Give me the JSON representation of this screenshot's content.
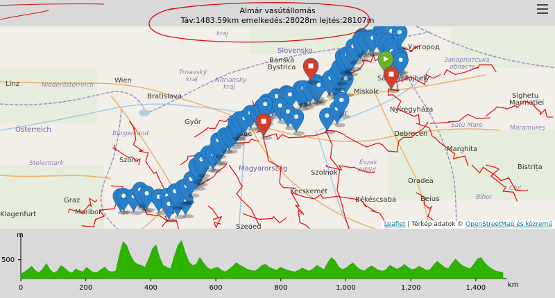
{
  "header": {
    "title": "Almár vasútállomás",
    "stats": "Táv:1483.59km emelkedés:28028m lejtés:28107m"
  },
  "map": {
    "places": [
      {
        "name": "Banská",
        "cls": "big"
      },
      {
        "name": "Bystrica",
        "cls": "big"
      },
      {
        "name": "Slovensko",
        "cls": "country"
      },
      {
        "name": "Ужгород",
        "cls": "big"
      },
      {
        "name": "Закарпатська",
        "cls": "region"
      },
      {
        "name": "область",
        "cls": "region"
      },
      {
        "name": "kraj",
        "cls": "region"
      },
      {
        "name": "Linz",
        "cls": "big"
      },
      {
        "name": "Niederösterreich",
        "cls": "region"
      },
      {
        "name": "Wien",
        "cls": "big"
      },
      {
        "name": "Trnavský",
        "cls": "region"
      },
      {
        "name": "kraj",
        "cls": "region"
      },
      {
        "name": "Nitriansky",
        "cls": "region"
      },
      {
        "name": "kraj",
        "cls": "region"
      },
      {
        "name": "Bratislava",
        "cls": "big"
      },
      {
        "name": "Sighetu",
        "cls": "big"
      },
      {
        "name": "Marmației",
        "cls": "big"
      },
      {
        "name": "Österreich",
        "cls": "country"
      },
      {
        "name": "Nyíregyháza",
        "cls": "big"
      },
      {
        "name": "Satu Mare",
        "cls": "region"
      },
      {
        "name": "Maramureș",
        "cls": "region"
      },
      {
        "name": "Eger",
        "cls": "big"
      },
      {
        "name": "Debrecen",
        "cls": "big"
      },
      {
        "name": "Burgenland",
        "cls": "region"
      },
      {
        "name": "Steiermark",
        "cls": "region"
      },
      {
        "name": "Marghita",
        "cls": "big"
      },
      {
        "name": "Bistrița",
        "cls": "big"
      },
      {
        "name": "Magyarország",
        "cls": "country"
      },
      {
        "name": "Szolnok",
        "cls": "big"
      },
      {
        "name": "Graz",
        "cls": "big"
      },
      {
        "name": "Oradea",
        "cls": "big"
      },
      {
        "name": "Kecskemét",
        "cls": "big"
      },
      {
        "name": "Cluj",
        "cls": "region"
      },
      {
        "name": "Zalaegerszeg",
        "cls": "big"
      },
      {
        "name": "Békéscsaba",
        "cls": "big"
      },
      {
        "name": "Beius",
        "cls": "big"
      },
      {
        "name": "Maribor",
        "cls": "big"
      },
      {
        "name": "Klagenfurt",
        "cls": "big"
      },
      {
        "name": "Szeged",
        "cls": "big"
      },
      {
        "name": "Észak",
        "cls": "region"
      },
      {
        "name": "Alföld",
        "cls": "region"
      },
      {
        "name": "Bihor",
        "cls": "region"
      },
      {
        "name": "Szom",
        "cls": "big"
      },
      {
        "name": "Győr",
        "cls": "big"
      },
      {
        "name": "Vác",
        "cls": "big"
      },
      {
        "name": "Sátoraljaújhely",
        "cls": "big"
      },
      {
        "name": "Miskolc",
        "cls": "big"
      }
    ],
    "attribution": {
      "leaflet": "Leaflet",
      "sep": " | Térkép adatok © ",
      "osm": "OpenStreetMap és közremű"
    }
  },
  "profile": {
    "y_axis_label": "m",
    "y_tick": "500",
    "x_unit": "km",
    "x_ticks": [
      "0",
      "200",
      "400",
      "600",
      "800",
      "1,000",
      "1,200",
      "1,400"
    ],
    "total_km": 1483.59,
    "fill_color": "#2db300",
    "elevation_samples_m": [
      120,
      180,
      250,
      330,
      210,
      160,
      260,
      400,
      240,
      150,
      200,
      350,
      280,
      190,
      150,
      260,
      210,
      180,
      300,
      220,
      160,
      170,
      240,
      310,
      200,
      180,
      200,
      650,
      980,
      880,
      620,
      450,
      380,
      350,
      300,
      520,
      780,
      900,
      560,
      350,
      300,
      260,
      580,
      880,
      1010,
      700,
      450,
      350,
      380,
      560,
      420,
      300,
      240,
      280,
      300,
      220,
      180,
      250,
      330,
      420,
      360,
      300,
      250,
      220,
      200,
      260,
      350,
      380,
      300,
      260,
      220,
      300,
      260,
      220,
      200,
      180,
      220,
      280,
      240,
      200,
      260,
      350,
      300,
      240,
      420,
      560,
      480,
      320,
      240,
      280,
      360,
      420,
      300,
      240,
      200,
      280,
      340,
      280,
      220,
      200,
      240,
      350,
      300,
      250,
      300,
      380,
      300,
      240,
      260,
      330,
      280,
      220,
      240,
      360,
      460,
      380,
      300,
      260,
      400,
      520,
      420,
      340,
      300,
      260,
      380,
      520,
      560,
      420,
      330,
      260,
      200,
      180,
      160
    ]
  },
  "colors": {
    "marker_blue": "#2a81cb",
    "marker_red": "#d63e2a",
    "marker_green": "#72b026",
    "route": "#e00000",
    "annotation": "#d01010"
  }
}
